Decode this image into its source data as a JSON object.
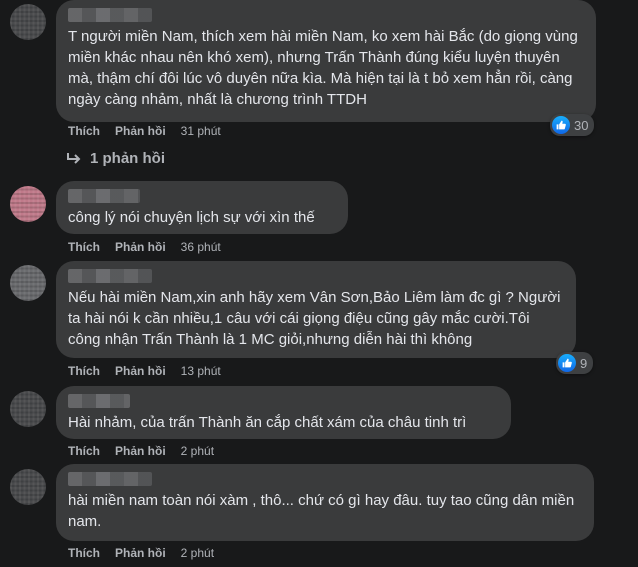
{
  "comments": [
    {
      "text": "T người miền Nam, thích xem hài miền Nam, ko xem hài Bắc (do giọng vùng miền khác nhau nên khó xem), nhưng Trấn Thành đúng kiểu luyện thuyên mà, thậm chí đôi lúc vô duyên nữa kìa. Mà hiện tại là t bỏ xem hẳn rồi, càng ngày càng nhảm, nhất là chương trình TTDH",
      "like": "Thích",
      "reply": "Phản hồi",
      "time": "31 phút",
      "reactions": "30"
    },
    {
      "text": "công lý nói chuyện lịch sự với xìn thế",
      "like": "Thích",
      "reply": "Phản hồi",
      "time": "36 phút"
    },
    {
      "text": "Nếu hài miền Nam,xin anh hãy xem Vân Sơn,Bảo Liêm làm đc gì ? Người ta hài nói k cần nhiều,1 câu với cái giọng điệu cũng gây mắc cười.Tôi công nhận Trấn Thành là 1 MC giỏi,nhưng diễn hài thì không",
      "like": "Thích",
      "reply": "Phản hồi",
      "time": "13 phút",
      "reactions": "9"
    },
    {
      "text": "Hài nhảm, của trấn Thành ăn cắp chất xám của châu tinh trì",
      "like": "Thích",
      "reply": "Phản hồi",
      "time": "2 phút"
    },
    {
      "text": "hài miền nam toàn nói xàm , thô... chứ có gì hay đâu. tuy tao cũng dân miền nam.",
      "like": "Thích",
      "reply": "Phản hồi",
      "time": "2 phút"
    }
  ],
  "replies_link": "1 phản hồi",
  "colors": {
    "bubble": "#3a3b3c",
    "background": "#18191a",
    "like_blue": "#1877f2"
  },
  "icons": {
    "reaction": "like-icon",
    "reply_arrow": "reply-arrow-icon"
  }
}
